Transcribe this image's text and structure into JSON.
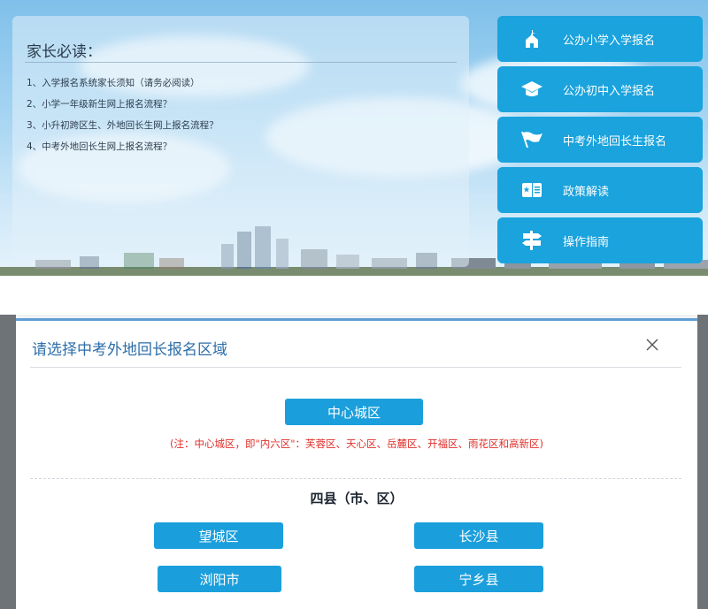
{
  "parent_notice": {
    "title": "家长必读：",
    "items": [
      "1、入学报名系统家长须知（请务必阅读）",
      "2、小学一年级新生网上报名流程？",
      "3、小升初跨区生、外地回长生网上报名流程？",
      "4、中考外地回长生网上报名流程？"
    ]
  },
  "menu": {
    "items": [
      {
        "label": "公办小学入学报名",
        "icon": "school-icon"
      },
      {
        "label": "公办初中入学报名",
        "icon": "graduation-cap-icon"
      },
      {
        "label": "中考外地回长生报名",
        "icon": "flag-icon"
      },
      {
        "label": "政策解读",
        "icon": "book-icon"
      },
      {
        "label": "操作指南",
        "icon": "signpost-icon"
      }
    ]
  },
  "modal": {
    "title": "请选择中考外地回长报名区域",
    "close": "×",
    "center_button": "中心城区",
    "note": "(注：中心城区，即\"内六区\"：芙蓉区、天心区、岳麓区、开福区、雨花区和高新区)",
    "counties_heading": "四县（市、区）",
    "counties": [
      "望城区",
      "长沙县",
      "浏阳市",
      "宁乡县"
    ]
  },
  "colors": {
    "accent": "#1aa3dd",
    "title_blue": "#2d6ea8",
    "note_red": "#e0302b"
  }
}
